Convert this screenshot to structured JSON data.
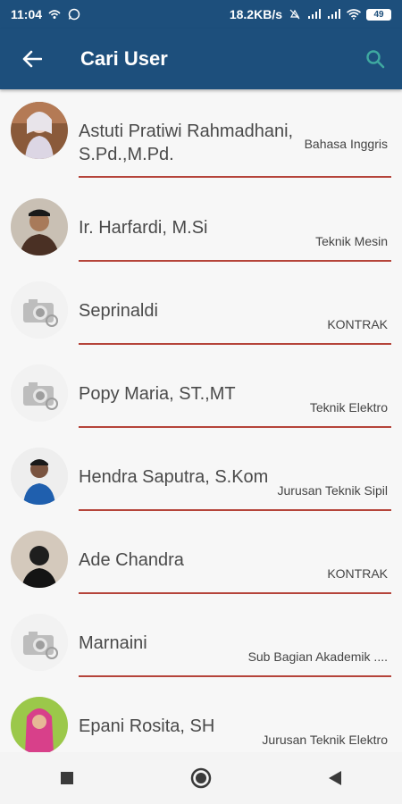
{
  "status": {
    "time": "11:04",
    "network_speed": "18.2KB/s",
    "battery": "49"
  },
  "appbar": {
    "title": "Cari User"
  },
  "users": [
    {
      "name": "Astuti Pratiwi Rahmadhani, S.Pd.,M.Pd.",
      "dept": "Bahasa Inggris",
      "avatar": "photo"
    },
    {
      "name": "Ir. Harfardi, M.Si",
      "dept": "Teknik Mesin",
      "avatar": "photo"
    },
    {
      "name": "Seprinaldi",
      "dept": "KONTRAK",
      "avatar": "placeholder"
    },
    {
      "name": "Popy Maria, ST.,MT",
      "dept": "Teknik Elektro",
      "avatar": "placeholder"
    },
    {
      "name": "Hendra Saputra, S.Kom",
      "dept": "Jurusan Teknik Sipil",
      "avatar": "photo"
    },
    {
      "name": "Ade Chandra",
      "dept": "KONTRAK",
      "avatar": "photo"
    },
    {
      "name": "Marnaini",
      "dept": "Sub Bagian Akademik ....",
      "avatar": "placeholder"
    },
    {
      "name": "Epani Rosita, SH",
      "dept": "Jurusan Teknik Elektro",
      "avatar": "photo"
    }
  ],
  "colors": {
    "primary": "#1d4f7c",
    "divider": "#b5443a",
    "search_icon": "#3fa9a0"
  }
}
